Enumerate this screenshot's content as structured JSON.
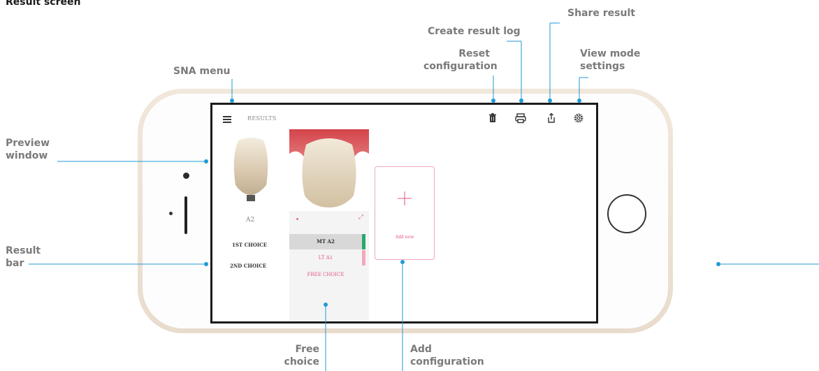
{
  "heading": "Result screen",
  "callouts": {
    "share_result": "Share result",
    "create_result_log": "Create result log",
    "reset_configuration": "Reset configuration",
    "view_mode_settings": "View mode settings",
    "sna_menu": "SNA menu",
    "preview_window": "Preview window",
    "result_bar": "Result bar",
    "free_choice": "Free choice",
    "add_configuration": "Add configuration"
  },
  "app": {
    "title": "RESULTS",
    "shade": "A2",
    "first_choice": "1ST CHOICE",
    "second_choice": "2ND CHOICE",
    "selected": "MT A2",
    "alternative": "LT A1",
    "free_choice": "FREE CHOICE",
    "add_new": "Add new"
  },
  "icons": {
    "menu": "hamburger-icon",
    "trash": "trash-icon",
    "print": "printer-icon",
    "share": "share-icon",
    "settings": "gear-icon",
    "expand": "expand-icon",
    "add": "plus-icon"
  },
  "colors": {
    "accent_blue": "#1f9ad6",
    "accent_pink": "#e2557d",
    "selected_green": "#2aa86a",
    "phone_gold": "#ede2d4"
  }
}
